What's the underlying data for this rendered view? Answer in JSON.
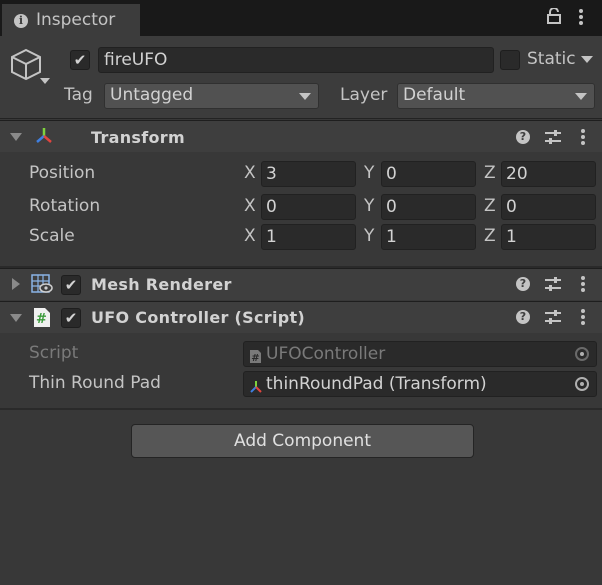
{
  "tab": {
    "title": "Inspector"
  },
  "header": {
    "name": "fireUFO",
    "static_label": "Static",
    "tag_label": "Tag",
    "tag_value": "Untagged",
    "layer_label": "Layer",
    "layer_value": "Default"
  },
  "transform": {
    "title": "Transform",
    "rows": [
      {
        "label": "Position",
        "x": "3",
        "y": "0",
        "z": "20"
      },
      {
        "label": "Rotation",
        "x": "0",
        "y": "0",
        "z": "0"
      },
      {
        "label": "Scale",
        "x": "1",
        "y": "1",
        "z": "1"
      }
    ],
    "axes": {
      "x": "X",
      "y": "Y",
      "z": "Z"
    }
  },
  "mesh_renderer": {
    "title": "Mesh Renderer"
  },
  "ufo_controller": {
    "title": "UFO Controller (Script)",
    "script_label": "Script",
    "script_value": "UFOController",
    "pad_label": "Thin Round Pad",
    "pad_value": "thinRoundPad (Transform)"
  },
  "add_component": "Add Component",
  "icons": {
    "tab": "info-icon",
    "lock": "lock-icon",
    "menu": "kebab-menu-icon",
    "gameobject": "cube-icon",
    "transform": "transform-axes-icon",
    "mesh": "mesh-renderer-icon",
    "script": "script-hash-icon",
    "help": "help-icon",
    "presets": "presets-icon"
  },
  "colors": {
    "background": "#383838",
    "panel": "#3e3e3e",
    "field": "#2a2a2a",
    "button": "#565656",
    "text": "#c4c4c4",
    "script_icon": "#3a9a3a"
  }
}
